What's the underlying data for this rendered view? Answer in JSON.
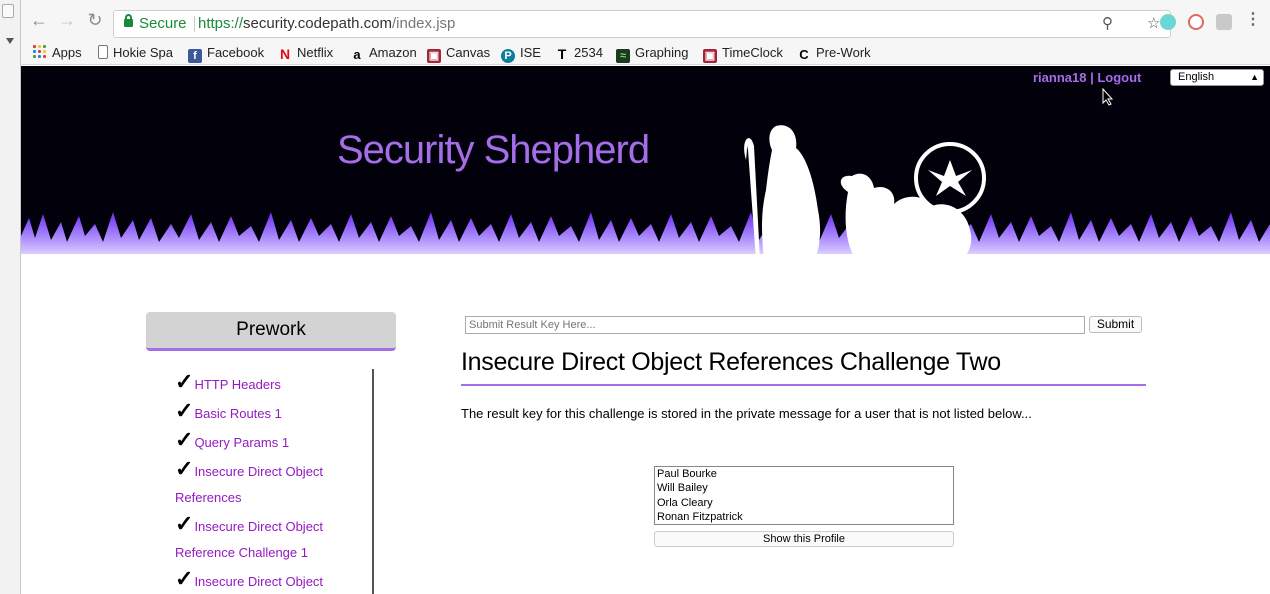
{
  "browser": {
    "secure_label": "Secure",
    "url_scheme": "https://",
    "url_domain": "security.codepath.com",
    "url_path": "/index.jsp"
  },
  "bookmarks": [
    {
      "label": "Apps",
      "icon": "apps-grid-icon"
    },
    {
      "label": "Hokie Spa",
      "icon": "page-icon"
    },
    {
      "label": "Facebook",
      "icon": "facebook-icon",
      "color": "#3b5998"
    },
    {
      "label": "Netflix",
      "icon": "netflix-icon",
      "color": "#e50914"
    },
    {
      "label": "Amazon",
      "icon": "amazon-icon"
    },
    {
      "label": "Canvas",
      "icon": "canvas-icon",
      "color": "#a32638"
    },
    {
      "label": "ISE",
      "icon": "ise-icon",
      "color": "#0e7c9c"
    },
    {
      "label": "2534",
      "icon": "t-icon"
    },
    {
      "label": "Graphing",
      "icon": "graphing-icon",
      "color": "#1c3a1c"
    },
    {
      "label": "TimeClock",
      "icon": "timeclock-icon",
      "color": "#a32638"
    },
    {
      "label": "Pre-Work",
      "icon": "codepath-icon"
    }
  ],
  "header": {
    "logo_text": "Security Shepherd",
    "user_links": "rianna18 | Logout",
    "language": "English",
    "accent": "#a46ee8"
  },
  "sidebar": {
    "title": "Prework",
    "items": [
      {
        "label": "HTTP Headers",
        "done": true
      },
      {
        "label": "Basic Routes 1",
        "done": true
      },
      {
        "label": "Query Params 1",
        "done": true
      },
      {
        "label": "Insecure Direct Object References",
        "done": true
      },
      {
        "label": "Insecure Direct Object Reference Challenge 1",
        "done": true
      },
      {
        "label": "Insecure Direct Object",
        "done": true
      }
    ],
    "check_glyph": "✓"
  },
  "main": {
    "result_placeholder": "Submit Result Key Here...",
    "submit_label": "Submit",
    "title": "Insecure Direct Object References Challenge Two",
    "description": "The result key for this challenge is stored in the private message for a user that is not listed below...",
    "users": [
      "Paul Bourke",
      "Will Bailey",
      "Orla Cleary",
      "Ronan Fitzpatrick"
    ],
    "show_button": "Show this Profile"
  }
}
